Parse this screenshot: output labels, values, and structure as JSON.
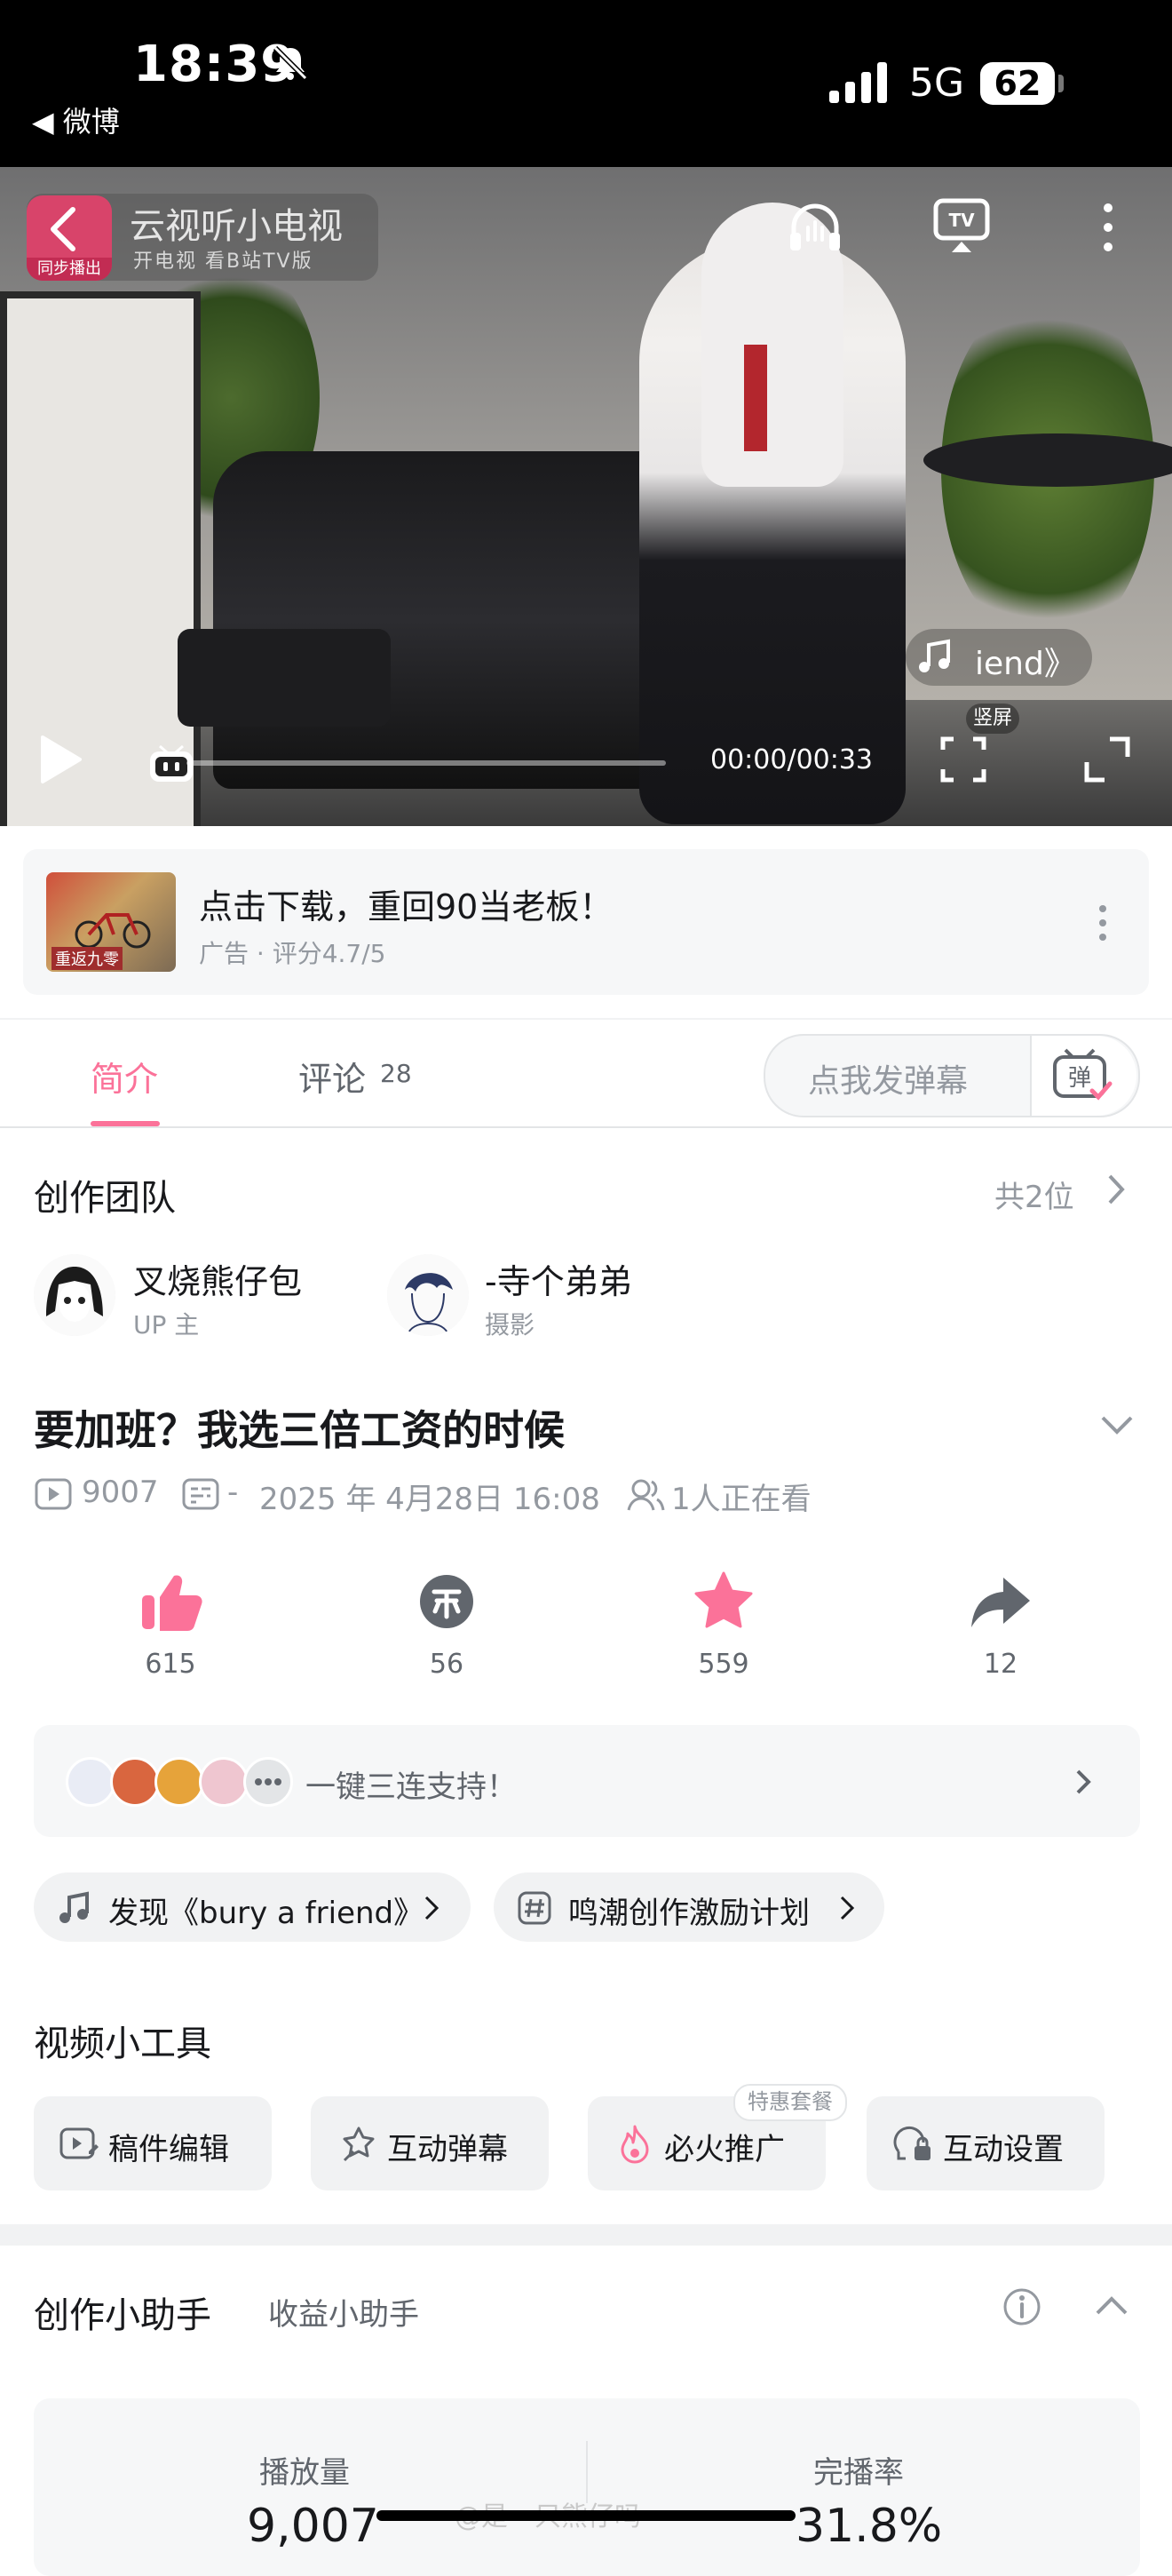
{
  "status_bar": {
    "time": "18:39",
    "back_app": "◀ 微博",
    "network": "5G",
    "battery": "62"
  },
  "player": {
    "channel_name": "云视听小电视",
    "channel_tagline": "开电视 看B站TV版",
    "channel_badge": "同步播出",
    "music_chip": "iend》",
    "vertical_label": "竖屏",
    "time": "00:00/00:33",
    "progress": 0.0
  },
  "ad_banner": {
    "title": "点击下载，重回90当老板！",
    "subtitle": "广告 · 评分4.7/5",
    "thumb_text": "重返九零"
  },
  "tabs": {
    "intro": "简介",
    "comments": "评论",
    "comments_count": "28",
    "danmaku_placeholder": "点我发弹幕"
  },
  "team": {
    "title": "创作团队",
    "count": "共2位",
    "members": [
      {
        "name": "叉烧熊仔包",
        "role": "UP 主"
      },
      {
        "name": "-寺个弟弟",
        "role": "摄影"
      }
    ]
  },
  "video": {
    "title": "要加班？我选三倍工资的时候",
    "views": "9007",
    "danmaku": "-",
    "date": "2025 年 4月28日 16:08",
    "watching": "1人正在看"
  },
  "actions": [
    {
      "label": "615",
      "icon": "like-icon"
    },
    {
      "label": "56",
      "icon": "coin-icon"
    },
    {
      "label": "559",
      "icon": "favorite-icon"
    },
    {
      "label": "12",
      "icon": "share-icon"
    }
  ],
  "triple": {
    "text": "一键三连支持！"
  },
  "chips": [
    {
      "label": "发现《bury a friend》",
      "icon": "music-icon"
    },
    {
      "label": "鸣潮创作激励计划",
      "icon": "hashtag-icon"
    }
  ],
  "tools": {
    "title": "视频小工具",
    "items": [
      {
        "label": "稿件编辑"
      },
      {
        "label": "互动弹幕"
      },
      {
        "label": "必火推广"
      },
      {
        "label": "互动设置"
      }
    ],
    "badge": "特惠套餐"
  },
  "assistant": {
    "title": "创作小助手",
    "tab": "收益小助手",
    "stats": [
      {
        "label": "播放量",
        "value": "9,007"
      },
      {
        "label": "完播率",
        "value": "31.8%"
      }
    ]
  },
  "watermark": "@是一只熊仔吗",
  "colors": {
    "accent": "#fb7299",
    "text": "#18191c",
    "muted": "#9499a0"
  }
}
